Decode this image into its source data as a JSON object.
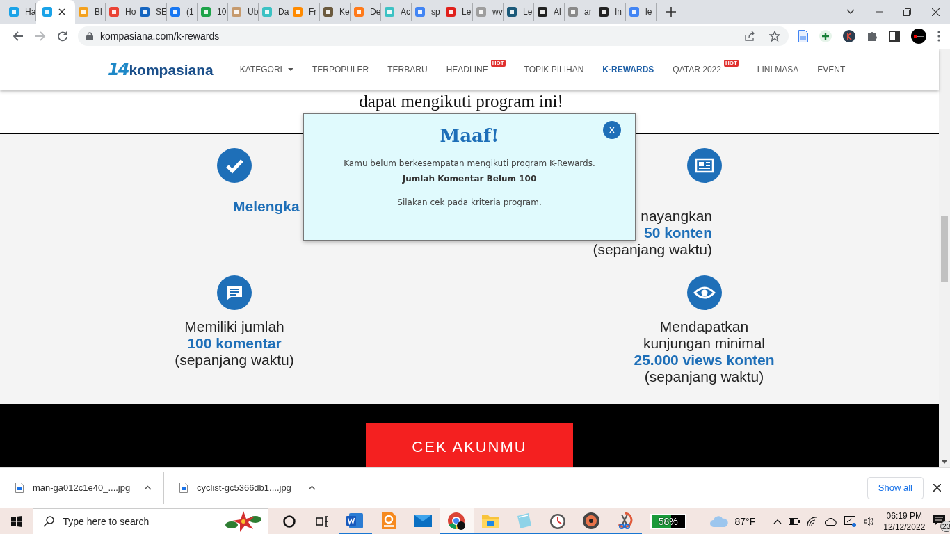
{
  "browser": {
    "tabs": [
      {
        "title": "Ha",
        "selected": false,
        "color": "#1aa3e8"
      },
      {
        "selected": true,
        "color": "#1aa3e8"
      },
      {
        "title": "Bl",
        "selected": false,
        "color": "#f4a11d"
      },
      {
        "title": "Ho",
        "selected": false,
        "color": "#ea4335"
      },
      {
        "title": "SE",
        "selected": false,
        "color": "#1565c0"
      },
      {
        "title": "(1",
        "selected": false,
        "color": "#1877f2"
      },
      {
        "title": "10",
        "selected": false,
        "color": "#1ea44a"
      },
      {
        "title": "Ub",
        "selected": false,
        "color": "#c69a6d"
      },
      {
        "title": "Da",
        "selected": false,
        "color": "#3cc2c4"
      },
      {
        "title": "Fr",
        "selected": false,
        "color": "#ff8a00"
      },
      {
        "title": "Ke",
        "selected": false,
        "color": "#6b5a3e"
      },
      {
        "title": "De",
        "selected": false,
        "color": "#ff7a1a"
      },
      {
        "title": "Ac",
        "selected": false,
        "color": "#3cc2c4"
      },
      {
        "title": "sp",
        "selected": false,
        "color": "#4285f4"
      },
      {
        "title": "Le",
        "selected": false,
        "color": "#e0201b"
      },
      {
        "title": "wv",
        "selected": false,
        "color": "#9e9e9e"
      },
      {
        "title": "Le",
        "selected": false,
        "color": "#1c5a7a"
      },
      {
        "title": "Al",
        "selected": false,
        "color": "#222222"
      },
      {
        "title": "ar",
        "selected": false,
        "color": "#8a8a8a"
      },
      {
        "title": "In",
        "selected": false,
        "color": "#222222"
      },
      {
        "title": "le",
        "selected": false,
        "color": "#4285f4"
      }
    ],
    "nav_buttons": [
      {
        "kind": "back",
        "disabled": false
      },
      {
        "kind": "forward",
        "disabled": true
      },
      {
        "kind": "reload",
        "disabled": false
      }
    ],
    "address": "kompasiana.com/k-rewards"
  },
  "site": {
    "logo": {
      "mark": "14",
      "name": "kompasiana"
    },
    "nav": [
      {
        "label": "KATEGORI",
        "dropdown": true,
        "selected": false
      },
      {
        "label": "TERPOPULER",
        "dropdown": false,
        "selected": false
      },
      {
        "label": "TERBARU",
        "dropdown": false,
        "selected": false
      },
      {
        "label": "HEADLINE",
        "badge": "HOT",
        "dropdown": false,
        "selected": false
      },
      {
        "label": "TOPIK PILIHAN",
        "dropdown": false,
        "selected": false
      },
      {
        "label": "K-REWARDS",
        "dropdown": false,
        "selected": true
      },
      {
        "label": "QATAR 2022",
        "badge": "HOT",
        "dropdown": false,
        "selected": false
      },
      {
        "label": "LINI MASA",
        "dropdown": false,
        "selected": false
      },
      {
        "label": "EVENT",
        "dropdown": false,
        "selected": false
      }
    ],
    "heading_fragment": "dapat mengikuti program ini!",
    "criteria": [
      {
        "kind": "check",
        "lines": [
          {
            "text": "Melengka",
            "emphasis": true
          }
        ]
      },
      {
        "kind": "newspaper",
        "lines": [
          {
            "text": "nayangkan",
            "emphasis": false
          },
          {
            "text": "50 konten",
            "emphasis": true
          },
          {
            "text": "(sepanjang waktu)",
            "emphasis": false
          }
        ]
      },
      {
        "kind": "comment",
        "lines": [
          {
            "text": "Memiliki jumlah",
            "emphasis": false
          },
          {
            "text": "100 komentar",
            "emphasis": true
          },
          {
            "text": "(sepanjang waktu)",
            "emphasis": false
          }
        ]
      },
      {
        "kind": "eye",
        "lines": [
          {
            "text": "Mendapatkan",
            "emphasis": false
          },
          {
            "text": "kunjungan minimal",
            "emphasis": false
          },
          {
            "text": "25.000 views konten",
            "emphasis": true
          },
          {
            "text": "(sepanjang waktu)",
            "emphasis": false
          }
        ]
      }
    ],
    "cta": "CEK AKUNMU",
    "modal": {
      "title": "Maaf!",
      "close": "x",
      "message": "Kamu belum berkesempatan mengikuti program K-Rewards.",
      "reason": "Jumlah Komentar Belum 100",
      "hint": "Silakan cek pada kriteria program."
    }
  },
  "downloads": {
    "items": [
      {
        "filename": "man-ga012c1e40_....jpg"
      },
      {
        "filename": "cyclist-gc5366db1....jpg"
      }
    ],
    "show_all": "Show all"
  },
  "taskbar": {
    "search_placeholder": "Type here to search",
    "apps": [
      {
        "kind": "word",
        "running": true,
        "active": false
      },
      {
        "kind": "pdf",
        "running": false,
        "active": false
      },
      {
        "kind": "mail",
        "running": false,
        "active": false
      },
      {
        "kind": "chrome",
        "running": true,
        "active": true
      },
      {
        "kind": "explorer",
        "running": true,
        "active": false
      },
      {
        "kind": "notepad",
        "running": true,
        "active": false
      },
      {
        "kind": "clock",
        "running": true,
        "active": false
      },
      {
        "kind": "music",
        "running": true,
        "active": false
      },
      {
        "kind": "snip",
        "running": true,
        "active": false
      }
    ],
    "battery_widget": {
      "reading": "58%",
      "level": 0.58
    },
    "weather": {
      "temperature": "87°F"
    },
    "time": "06:19 PM",
    "date": "12/12/2022",
    "notifications": "23"
  }
}
